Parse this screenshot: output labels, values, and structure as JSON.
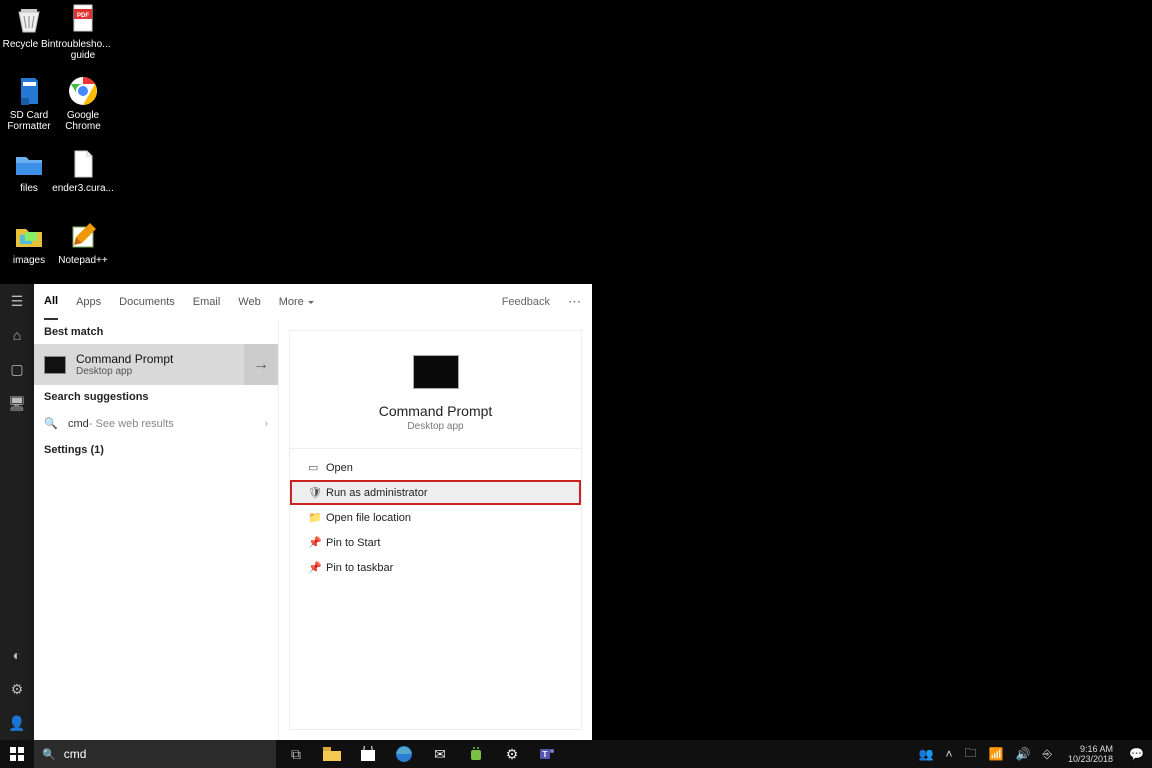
{
  "desktop": {
    "icons": [
      {
        "label": "Recycle Bin"
      },
      {
        "label": "troublesho... guide"
      },
      {
        "label": "SD Card Formatter"
      },
      {
        "label": "Google Chrome"
      },
      {
        "label": "files"
      },
      {
        "label": "ender3.cura..."
      },
      {
        "label": "images"
      },
      {
        "label": "Notepad++"
      }
    ]
  },
  "search": {
    "tabs": {
      "all": "All",
      "apps": "Apps",
      "documents": "Documents",
      "email": "Email",
      "web": "Web",
      "more": "More"
    },
    "feedback": "Feedback",
    "sections": {
      "best_match": "Best match",
      "suggestions": "Search suggestions",
      "settings": "Settings (1)"
    },
    "best_match": {
      "title": "Command Prompt",
      "subtitle": "Desktop app"
    },
    "suggestion": {
      "query": "cmd",
      "hint": " - See web results"
    },
    "preview": {
      "title": "Command Prompt",
      "subtitle": "Desktop app"
    },
    "actions": {
      "open": "Open",
      "run_admin": "Run as administrator",
      "open_loc": "Open file location",
      "pin_start": "Pin to Start",
      "pin_taskbar": "Pin to taskbar"
    },
    "input_value": "cmd"
  },
  "taskbar": {
    "clock": {
      "time": "9:16 AM",
      "date": "10/23/2018"
    }
  }
}
